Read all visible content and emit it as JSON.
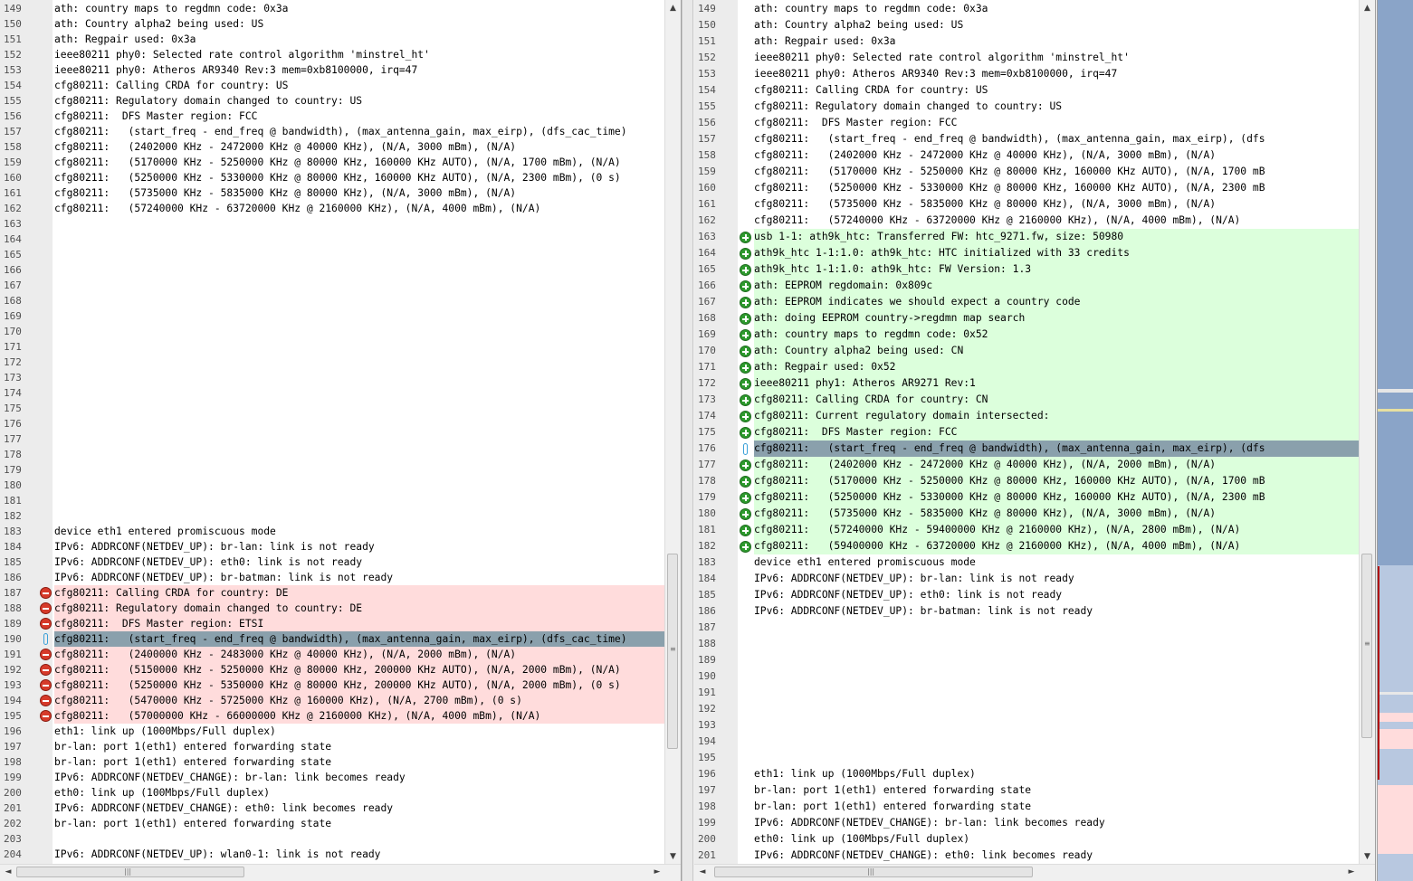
{
  "app": {
    "scroll_glyphs": {
      "up": "▲",
      "down": "▼",
      "left": "◄",
      "right": "►",
      "grip_h": "|||",
      "grip_v": "≡"
    }
  },
  "colors": {
    "deleted": "#ffdcdc",
    "added": "#dcffdc",
    "blank": "#e2e2e2",
    "selected": "#8aa0ac"
  },
  "left_pane": {
    "rows": [
      {
        "n": "149",
        "type": "",
        "text": "ath: country maps to regdmn code: 0x3a"
      },
      {
        "n": "150",
        "type": "",
        "text": "ath: Country alpha2 being used: US"
      },
      {
        "n": "151",
        "type": "",
        "text": "ath: Regpair used: 0x3a"
      },
      {
        "n": "152",
        "type": "",
        "text": "ieee80211 phy0: Selected rate control algorithm 'minstrel_ht'"
      },
      {
        "n": "153",
        "type": "",
        "text": "ieee80211 phy0: Atheros AR9340 Rev:3 mem=0xb8100000, irq=47"
      },
      {
        "n": "154",
        "type": "",
        "text": "cfg80211: Calling CRDA for country: US"
      },
      {
        "n": "155",
        "type": "",
        "text": "cfg80211: Regulatory domain changed to country: US"
      },
      {
        "n": "156",
        "type": "",
        "text": "cfg80211:  DFS Master region: FCC"
      },
      {
        "n": "157",
        "type": "",
        "text": "cfg80211:   (start_freq - end_freq @ bandwidth), (max_antenna_gain, max_eirp), (dfs_cac_time)"
      },
      {
        "n": "158",
        "type": "",
        "text": "cfg80211:   (2402000 KHz - 2472000 KHz @ 40000 KHz), (N/A, 3000 mBm), (N/A)"
      },
      {
        "n": "159",
        "type": "",
        "text": "cfg80211:   (5170000 KHz - 5250000 KHz @ 80000 KHz, 160000 KHz AUTO), (N/A, 1700 mBm), (N/A)"
      },
      {
        "n": "160",
        "type": "",
        "text": "cfg80211:   (5250000 KHz - 5330000 KHz @ 80000 KHz, 160000 KHz AUTO), (N/A, 2300 mBm), (0 s)"
      },
      {
        "n": "161",
        "type": "",
        "text": "cfg80211:   (5735000 KHz - 5835000 KHz @ 80000 KHz), (N/A, 3000 mBm), (N/A)"
      },
      {
        "n": "162",
        "type": "",
        "text": "cfg80211:   (57240000 KHz - 63720000 KHz @ 2160000 KHz), (N/A, 4000 mBm), (N/A)"
      },
      {
        "n": "163",
        "type": "blank",
        "text": ""
      },
      {
        "n": "164",
        "type": "blank",
        "text": ""
      },
      {
        "n": "165",
        "type": "blank",
        "text": ""
      },
      {
        "n": "166",
        "type": "blank",
        "text": ""
      },
      {
        "n": "167",
        "type": "blank",
        "text": ""
      },
      {
        "n": "168",
        "type": "blank",
        "text": ""
      },
      {
        "n": "169",
        "type": "blank",
        "text": ""
      },
      {
        "n": "170",
        "type": "blank",
        "text": ""
      },
      {
        "n": "171",
        "type": "blank",
        "text": ""
      },
      {
        "n": "172",
        "type": "blank",
        "text": ""
      },
      {
        "n": "173",
        "type": "blank",
        "text": ""
      },
      {
        "n": "174",
        "type": "blank",
        "text": ""
      },
      {
        "n": "175",
        "type": "blank",
        "text": ""
      },
      {
        "n": "176",
        "type": "blank",
        "text": ""
      },
      {
        "n": "177",
        "type": "blank",
        "text": ""
      },
      {
        "n": "178",
        "type": "blank",
        "text": ""
      },
      {
        "n": "179",
        "type": "blank",
        "text": ""
      },
      {
        "n": "180",
        "type": "blank",
        "text": ""
      },
      {
        "n": "181",
        "type": "blank",
        "text": ""
      },
      {
        "n": "182",
        "type": "blank",
        "text": ""
      },
      {
        "n": "183",
        "type": "",
        "text": "device eth1 entered promiscuous mode"
      },
      {
        "n": "184",
        "type": "",
        "text": "IPv6: ADDRCONF(NETDEV_UP): br-lan: link is not ready"
      },
      {
        "n": "185",
        "type": "",
        "text": "IPv6: ADDRCONF(NETDEV_UP): eth0: link is not ready"
      },
      {
        "n": "186",
        "type": "",
        "text": "IPv6: ADDRCONF(NETDEV_UP): br-batman: link is not ready"
      },
      {
        "n": "187",
        "type": "del",
        "text": "cfg80211: Calling CRDA for country: DE"
      },
      {
        "n": "188",
        "type": "del",
        "text": "cfg80211: Regulatory domain changed to country: DE"
      },
      {
        "n": "189",
        "type": "del",
        "text": "cfg80211:  DFS Master region: ETSI"
      },
      {
        "n": "190",
        "type": "sel",
        "text": "cfg80211:   (start_freq - end_freq @ bandwidth), (max_antenna_gain, max_eirp), (dfs_cac_time)"
      },
      {
        "n": "191",
        "type": "del",
        "text": "cfg80211:   (2400000 KHz - 2483000 KHz @ 40000 KHz), (N/A, 2000 mBm), (N/A)"
      },
      {
        "n": "192",
        "type": "del",
        "text": "cfg80211:   (5150000 KHz - 5250000 KHz @ 80000 KHz, 200000 KHz AUTO), (N/A, 2000 mBm), (N/A)"
      },
      {
        "n": "193",
        "type": "del",
        "text": "cfg80211:   (5250000 KHz - 5350000 KHz @ 80000 KHz, 200000 KHz AUTO), (N/A, 2000 mBm), (0 s)"
      },
      {
        "n": "194",
        "type": "del",
        "text": "cfg80211:   (5470000 KHz - 5725000 KHz @ 160000 KHz), (N/A, 2700 mBm), (0 s)"
      },
      {
        "n": "195",
        "type": "del",
        "text": "cfg80211:   (57000000 KHz - 66000000 KHz @ 2160000 KHz), (N/A, 4000 mBm), (N/A)"
      },
      {
        "n": "196",
        "type": "",
        "text": "eth1: link up (1000Mbps/Full duplex)"
      },
      {
        "n": "197",
        "type": "",
        "text": "br-lan: port 1(eth1) entered forwarding state"
      },
      {
        "n": "198",
        "type": "",
        "text": "br-lan: port 1(eth1) entered forwarding state"
      },
      {
        "n": "199",
        "type": "",
        "text": "IPv6: ADDRCONF(NETDEV_CHANGE): br-lan: link becomes ready"
      },
      {
        "n": "200",
        "type": "",
        "text": "eth0: link up (100Mbps/Full duplex)"
      },
      {
        "n": "201",
        "type": "",
        "text": "IPv6: ADDRCONF(NETDEV_CHANGE): eth0: link becomes ready"
      },
      {
        "n": "202",
        "type": "",
        "text": "br-lan: port 1(eth1) entered forwarding state"
      },
      {
        "n": "203",
        "type": "blank",
        "text": ""
      },
      {
        "n": "204",
        "type": "",
        "text": "IPv6: ADDRCONF(NETDEV_UP): wlan0-1: link is not ready"
      }
    ]
  },
  "right_pane": {
    "rows": [
      {
        "n": "149",
        "type": "",
        "text": "ath: country maps to regdmn code: 0x3a"
      },
      {
        "n": "150",
        "type": "",
        "text": "ath: Country alpha2 being used: US"
      },
      {
        "n": "151",
        "type": "",
        "text": "ath: Regpair used: 0x3a"
      },
      {
        "n": "152",
        "type": "",
        "text": "ieee80211 phy0: Selected rate control algorithm 'minstrel_ht'"
      },
      {
        "n": "153",
        "type": "",
        "text": "ieee80211 phy0: Atheros AR9340 Rev:3 mem=0xb8100000, irq=47"
      },
      {
        "n": "154",
        "type": "",
        "text": "cfg80211: Calling CRDA for country: US"
      },
      {
        "n": "155",
        "type": "",
        "text": "cfg80211: Regulatory domain changed to country: US"
      },
      {
        "n": "156",
        "type": "",
        "text": "cfg80211:  DFS Master region: FCC"
      },
      {
        "n": "157",
        "type": "",
        "text": "cfg80211:   (start_freq - end_freq @ bandwidth), (max_antenna_gain, max_eirp), (dfs"
      },
      {
        "n": "158",
        "type": "",
        "text": "cfg80211:   (2402000 KHz - 2472000 KHz @ 40000 KHz), (N/A, 3000 mBm), (N/A)"
      },
      {
        "n": "159",
        "type": "",
        "text": "cfg80211:   (5170000 KHz - 5250000 KHz @ 80000 KHz, 160000 KHz AUTO), (N/A, 1700 mB"
      },
      {
        "n": "160",
        "type": "",
        "text": "cfg80211:   (5250000 KHz - 5330000 KHz @ 80000 KHz, 160000 KHz AUTO), (N/A, 2300 mB"
      },
      {
        "n": "161",
        "type": "",
        "text": "cfg80211:   (5735000 KHz - 5835000 KHz @ 80000 KHz), (N/A, 3000 mBm), (N/A)"
      },
      {
        "n": "162",
        "type": "",
        "text": "cfg80211:   (57240000 KHz - 63720000 KHz @ 2160000 KHz), (N/A, 4000 mBm), (N/A)"
      },
      {
        "n": "163",
        "type": "add",
        "text": "usb 1-1: ath9k_htc: Transferred FW: htc_9271.fw, size: 50980"
      },
      {
        "n": "164",
        "type": "add",
        "text": "ath9k_htc 1-1:1.0: ath9k_htc: HTC initialized with 33 credits"
      },
      {
        "n": "165",
        "type": "add",
        "text": "ath9k_htc 1-1:1.0: ath9k_htc: FW Version: 1.3"
      },
      {
        "n": "166",
        "type": "add",
        "text": "ath: EEPROM regdomain: 0x809c"
      },
      {
        "n": "167",
        "type": "add",
        "text": "ath: EEPROM indicates we should expect a country code"
      },
      {
        "n": "168",
        "type": "add",
        "text": "ath: doing EEPROM country->regdmn map search"
      },
      {
        "n": "169",
        "type": "add",
        "text": "ath: country maps to regdmn code: 0x52"
      },
      {
        "n": "170",
        "type": "add",
        "text": "ath: Country alpha2 being used: CN"
      },
      {
        "n": "171",
        "type": "add",
        "text": "ath: Regpair used: 0x52"
      },
      {
        "n": "172",
        "type": "add",
        "text": "ieee80211 phy1: Atheros AR9271 Rev:1"
      },
      {
        "n": "173",
        "type": "add",
        "text": "cfg80211: Calling CRDA for country: CN"
      },
      {
        "n": "174",
        "type": "add",
        "text": "cfg80211: Current regulatory domain intersected:"
      },
      {
        "n": "175",
        "type": "add",
        "text": "cfg80211:  DFS Master region: FCC"
      },
      {
        "n": "176",
        "type": "sel",
        "text": "cfg80211:   (start_freq - end_freq @ bandwidth), (max_antenna_gain, max_eirp), (dfs"
      },
      {
        "n": "177",
        "type": "add",
        "text": "cfg80211:   (2402000 KHz - 2472000 KHz @ 40000 KHz), (N/A, 2000 mBm), (N/A)"
      },
      {
        "n": "178",
        "type": "add",
        "text": "cfg80211:   (5170000 KHz - 5250000 KHz @ 80000 KHz, 160000 KHz AUTO), (N/A, 1700 mB"
      },
      {
        "n": "179",
        "type": "add",
        "text": "cfg80211:   (5250000 KHz - 5330000 KHz @ 80000 KHz, 160000 KHz AUTO), (N/A, 2300 mB"
      },
      {
        "n": "180",
        "type": "add",
        "text": "cfg80211:   (5735000 KHz - 5835000 KHz @ 80000 KHz), (N/A, 3000 mBm), (N/A)"
      },
      {
        "n": "181",
        "type": "add",
        "text": "cfg80211:   (57240000 KHz - 59400000 KHz @ 2160000 KHz), (N/A, 2800 mBm), (N/A)"
      },
      {
        "n": "182",
        "type": "add",
        "text": "cfg80211:   (59400000 KHz - 63720000 KHz @ 2160000 KHz), (N/A, 4000 mBm), (N/A)"
      },
      {
        "n": "183",
        "type": "",
        "text": "device eth1 entered promiscuous mode"
      },
      {
        "n": "184",
        "type": "",
        "text": "IPv6: ADDRCONF(NETDEV_UP): br-lan: link is not ready"
      },
      {
        "n": "185",
        "type": "",
        "text": "IPv6: ADDRCONF(NETDEV_UP): eth0: link is not ready"
      },
      {
        "n": "186",
        "type": "",
        "text": "IPv6: ADDRCONF(NETDEV_UP): br-batman: link is not ready"
      },
      {
        "n": "187",
        "type": "blank",
        "text": ""
      },
      {
        "n": "188",
        "type": "blank",
        "text": ""
      },
      {
        "n": "189",
        "type": "blank",
        "text": ""
      },
      {
        "n": "190",
        "type": "blank",
        "text": ""
      },
      {
        "n": "191",
        "type": "blank",
        "text": ""
      },
      {
        "n": "192",
        "type": "blank",
        "text": ""
      },
      {
        "n": "193",
        "type": "blank",
        "text": ""
      },
      {
        "n": "194",
        "type": "blank",
        "text": ""
      },
      {
        "n": "195",
        "type": "blank",
        "text": ""
      },
      {
        "n": "196",
        "type": "",
        "text": "eth1: link up (1000Mbps/Full duplex)"
      },
      {
        "n": "197",
        "type": "",
        "text": "br-lan: port 1(eth1) entered forwarding state"
      },
      {
        "n": "198",
        "type": "",
        "text": "br-lan: port 1(eth1) entered forwarding state"
      },
      {
        "n": "199",
        "type": "",
        "text": "IPv6: ADDRCONF(NETDEV_CHANGE): br-lan: link becomes ready"
      },
      {
        "n": "200",
        "type": "",
        "text": "eth0: link up (100Mbps/Full duplex)"
      },
      {
        "n": "201",
        "type": "",
        "text": "IPv6: ADDRCONF(NETDEV_CHANGE): eth0: link becomes ready"
      }
    ]
  },
  "overview": {
    "base_color": "#8aa4c8"
  }
}
